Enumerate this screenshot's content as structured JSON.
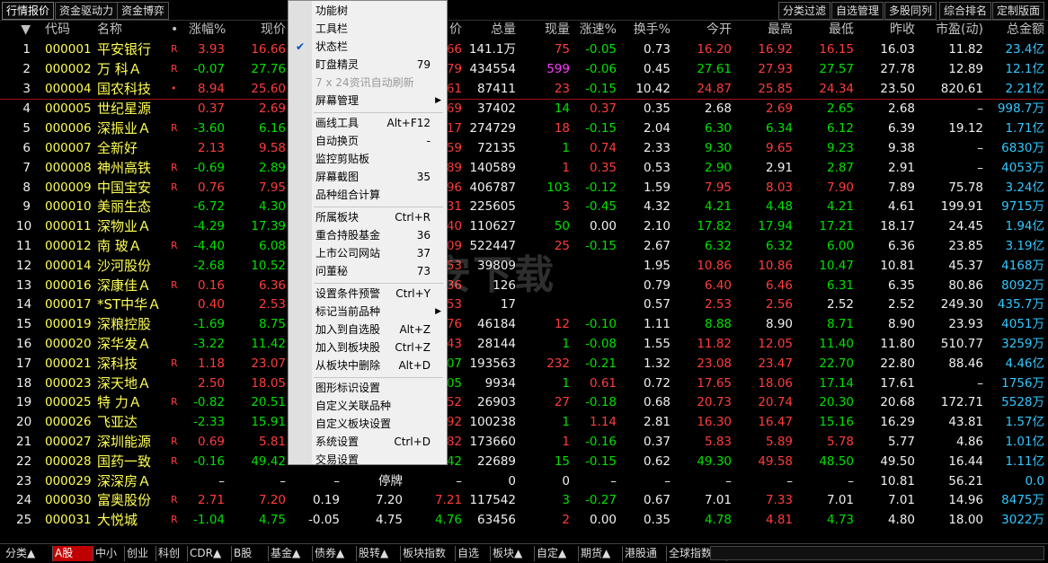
{
  "top_tabs_left": [
    "行情报价",
    "资金驱动力",
    "资金博弈"
  ],
  "top_tabs_right": [
    "分类过滤",
    "自选管理",
    "多股同列",
    "综合排名",
    "定制版面"
  ],
  "header": [
    "▼",
    "代码",
    "名称",
    "•",
    "涨幅%",
    "现价",
    "",
    "",
    "价",
    "总量",
    "现量",
    "涨速%",
    "换手%",
    "今开",
    "最高",
    "最低",
    "昨收",
    "市盈(动)",
    "总金额"
  ],
  "rows": [
    {
      "n": "1",
      "code": "000001",
      "name": "平安银行",
      "mark": "R",
      "chg": "3.93",
      "price": "16.66",
      "hidden1": "",
      "hidden2": "",
      "p2": "66",
      "vol": "141.1万",
      "cur": "75",
      "spd": "-0.05",
      "turn": "0.73",
      "open": "16.20",
      "high": "16.92",
      "low": "16.15",
      "prev": "16.03",
      "pe": "11.82",
      "amt": "23.4亿"
    },
    {
      "n": "2",
      "code": "000002",
      "name": "万 科Ａ",
      "mark": "R",
      "chg": "-0.07",
      "price": "27.76",
      "hidden1": "",
      "hidden2": "",
      "p2": "79",
      "vol": "434554",
      "cur": "599",
      "spd": "-0.06",
      "turn": "0.45",
      "open": "27.61",
      "high": "27.93",
      "low": "27.57",
      "prev": "27.78",
      "pe": "12.89",
      "amt": "12.1亿"
    },
    {
      "n": "3",
      "code": "000004",
      "name": "国农科技",
      "mark": "•",
      "chg": "8.94",
      "price": "25.60",
      "hidden1": "",
      "hidden2": "",
      "p2": "61",
      "vol": "87411",
      "cur": "23",
      "spd": "-0.15",
      "turn": "10.42",
      "open": "24.87",
      "high": "25.85",
      "low": "24.34",
      "prev": "23.50",
      "pe": "820.61",
      "amt": "2.21亿"
    },
    {
      "n": "4",
      "code": "000005",
      "name": "世纪星源",
      "mark": "",
      "chg": "0.37",
      "price": "2.69",
      "hidden1": "",
      "hidden2": "",
      "p2": "69",
      "vol": "37402",
      "cur": "14",
      "spd": "0.37",
      "turn": "0.35",
      "open": "2.68",
      "high": "2.69",
      "low": "2.65",
      "prev": "2.68",
      "pe": "–",
      "amt": "998.7万"
    },
    {
      "n": "5",
      "code": "000006",
      "name": "深振业Ａ",
      "mark": "R",
      "chg": "-3.60",
      "price": "6.16",
      "hidden1": "",
      "hidden2": "",
      "p2": "17",
      "vol": "274729",
      "cur": "18",
      "spd": "-0.15",
      "turn": "2.04",
      "open": "6.30",
      "high": "6.34",
      "low": "6.12",
      "prev": "6.39",
      "pe": "19.12",
      "amt": "1.71亿"
    },
    {
      "n": "6",
      "code": "000007",
      "name": "全新好",
      "mark": "",
      "chg": "2.13",
      "price": "9.58",
      "hidden1": "",
      "hidden2": "",
      "p2": "59",
      "vol": "72135",
      "cur": "1",
      "spd": "0.74",
      "turn": "2.33",
      "open": "9.30",
      "high": "9.65",
      "low": "9.23",
      "prev": "9.38",
      "pe": "–",
      "amt": "6830万"
    },
    {
      "n": "7",
      "code": "000008",
      "name": "神州高铁",
      "mark": "R",
      "chg": "-0.69",
      "price": "2.89",
      "hidden1": "",
      "hidden2": "",
      "p2": "89",
      "vol": "140589",
      "cur": "1",
      "spd": "0.35",
      "turn": "0.53",
      "open": "2.90",
      "high": "2.91",
      "low": "2.87",
      "prev": "2.91",
      "pe": "–",
      "amt": "4053万"
    },
    {
      "n": "8",
      "code": "000009",
      "name": "中国宝安",
      "mark": "R",
      "chg": "0.76",
      "price": "7.95",
      "hidden1": "",
      "hidden2": "",
      "p2": "96",
      "vol": "406787",
      "cur": "103",
      "spd": "-0.12",
      "turn": "1.59",
      "open": "7.95",
      "high": "8.03",
      "low": "7.90",
      "prev": "7.89",
      "pe": "75.78",
      "amt": "3.24亿"
    },
    {
      "n": "9",
      "code": "000010",
      "name": "美丽生态",
      "mark": "",
      "chg": "-6.72",
      "price": "4.30",
      "hidden1": "",
      "hidden2": "",
      "p2": "31",
      "vol": "225605",
      "cur": "3",
      "spd": "-0.45",
      "turn": "4.32",
      "open": "4.21",
      "high": "4.48",
      "low": "4.21",
      "prev": "4.61",
      "pe": "199.91",
      "amt": "9715万"
    },
    {
      "n": "10",
      "code": "000011",
      "name": "深物业Ａ",
      "mark": "",
      "chg": "-4.29",
      "price": "17.39",
      "hidden1": "",
      "hidden2": "",
      "p2": "40",
      "vol": "110627",
      "cur": "50",
      "spd": "0.00",
      "turn": "2.10",
      "open": "17.82",
      "high": "17.94",
      "low": "17.21",
      "prev": "18.17",
      "pe": "24.45",
      "amt": "1.94亿"
    },
    {
      "n": "11",
      "code": "000012",
      "name": "南 玻Ａ",
      "mark": "R",
      "chg": "-4.40",
      "price": "6.08",
      "hidden1": "",
      "hidden2": "",
      "p2": "09",
      "vol": "522447",
      "cur": "25",
      "spd": "-0.15",
      "turn": "2.67",
      "open": "6.32",
      "high": "6.32",
      "low": "6.00",
      "prev": "6.36",
      "pe": "23.85",
      "amt": "3.19亿"
    },
    {
      "n": "12",
      "code": "000014",
      "name": "沙河股份",
      "mark": "",
      "chg": "-2.68",
      "price": "10.52",
      "hidden1": "",
      "hidden2": "",
      "p2": "53",
      "vol": "39809",
      "cur": "",
      "spd": "",
      "turn": "1.95",
      "open": "10.86",
      "high": "10.86",
      "low": "10.47",
      "prev": "10.81",
      "pe": "45.37",
      "amt": "4168万"
    },
    {
      "n": "13",
      "code": "000016",
      "name": "深康佳Ａ",
      "mark": "R",
      "chg": "0.16",
      "price": "6.36",
      "hidden1": "",
      "hidden2": "",
      "p2": "36",
      "vol": "126",
      "cur": "",
      "spd": "",
      "turn": "0.79",
      "open": "6.40",
      "high": "6.46",
      "low": "6.31",
      "prev": "6.35",
      "pe": "80.86",
      "amt": "8092万"
    },
    {
      "n": "14",
      "code": "000017",
      "name": "*ST中华Ａ",
      "mark": "",
      "chg": "0.40",
      "price": "2.53",
      "hidden1": "",
      "hidden2": "",
      "p2": "53",
      "vol": "17",
      "cur": "",
      "spd": "",
      "turn": "0.57",
      "open": "2.53",
      "high": "2.56",
      "low": "2.52",
      "prev": "2.52",
      "pe": "249.30",
      "amt": "435.7万"
    },
    {
      "n": "15",
      "code": "000019",
      "name": "深粮控股",
      "mark": "",
      "chg": "-1.69",
      "price": "8.75",
      "hidden1": "",
      "hidden2": "",
      "p2": "76",
      "vol": "46184",
      "cur": "12",
      "spd": "-0.10",
      "turn": "1.11",
      "open": "8.88",
      "high": "8.90",
      "low": "8.71",
      "prev": "8.90",
      "pe": "23.93",
      "amt": "4051万"
    },
    {
      "n": "16",
      "code": "000020",
      "name": "深华发Ａ",
      "mark": "",
      "chg": "-3.22",
      "price": "11.42",
      "hidden1": "",
      "hidden2": "",
      "p2": "43",
      "vol": "28144",
      "cur": "1",
      "spd": "-0.08",
      "turn": "1.55",
      "open": "11.82",
      "high": "12.05",
      "low": "11.40",
      "prev": "11.80",
      "pe": "510.77",
      "amt": "3259万"
    },
    {
      "n": "17",
      "code": "000021",
      "name": "深科技",
      "mark": "R",
      "chg": "1.18",
      "price": "23.07",
      "hidden1": "",
      "hidden2": "",
      "p2": "07",
      "vol": "193563",
      "cur": "232",
      "spd": "-0.21",
      "turn": "1.32",
      "open": "23.08",
      "high": "23.47",
      "low": "22.70",
      "prev": "22.80",
      "pe": "88.46",
      "amt": "4.46亿"
    },
    {
      "n": "18",
      "code": "000023",
      "name": "深天地Ａ",
      "mark": "",
      "chg": "2.50",
      "price": "18.05",
      "hidden1": "",
      "hidden2": "",
      "p2": "05",
      "vol": "9934",
      "cur": "1",
      "spd": "0.61",
      "turn": "0.72",
      "open": "17.65",
      "high": "18.06",
      "low": "17.14",
      "prev": "17.61",
      "pe": "–",
      "amt": "1756万"
    },
    {
      "n": "19",
      "code": "000025",
      "name": "特 力Ａ",
      "mark": "R",
      "chg": "-0.82",
      "price": "20.51",
      "hidden1": "",
      "hidden2": "",
      "p2": "52",
      "vol": "26903",
      "cur": "27",
      "spd": "-0.18",
      "turn": "0.68",
      "open": "20.73",
      "high": "20.74",
      "low": "20.30",
      "prev": "20.68",
      "pe": "172.71",
      "amt": "5528万"
    },
    {
      "n": "20",
      "code": "000026",
      "name": "飞亚达",
      "mark": "",
      "chg": "-2.33",
      "price": "15.91",
      "hidden1": "",
      "hidden2": "",
      "p2": "92",
      "vol": "100238",
      "cur": "1",
      "spd": "1.14",
      "turn": "2.81",
      "open": "16.30",
      "high": "16.47",
      "low": "15.16",
      "prev": "16.29",
      "pe": "43.81",
      "amt": "1.57亿"
    },
    {
      "n": "21",
      "code": "000027",
      "name": "深圳能源",
      "mark": "R",
      "chg": "0.69",
      "price": "5.81",
      "hidden1": "",
      "hidden2": "",
      "p2": "82",
      "vol": "173660",
      "cur": "1",
      "spd": "-0.16",
      "turn": "0.37",
      "open": "5.83",
      "high": "5.89",
      "low": "5.78",
      "prev": "5.77",
      "pe": "4.86",
      "amt": "1.01亿"
    },
    {
      "n": "22",
      "code": "000028",
      "name": "国药一致",
      "mark": "R",
      "chg": "-0.16",
      "price": "49.42",
      "hidden1": "",
      "hidden2": "",
      "p2": "42",
      "vol": "22689",
      "cur": "15",
      "spd": "-0.15",
      "turn": "0.62",
      "open": "49.30",
      "high": "49.58",
      "low": "48.50",
      "prev": "49.50",
      "pe": "16.44",
      "amt": "1.11亿"
    },
    {
      "n": "23",
      "code": "000029",
      "name": "深深房Ａ",
      "mark": "",
      "chg": "–",
      "price": "–",
      "hidden1": "–",
      "hidden2": "停牌",
      "p2": "–",
      "vol": "0",
      "cur": "0",
      "spd": "–",
      "turn": "–",
      "open": "–",
      "high": "–",
      "low": "–",
      "prev": "10.81",
      "pe": "56.21",
      "amt": "0.0"
    },
    {
      "n": "24",
      "code": "000030",
      "name": "富奥股份",
      "mark": "R",
      "chg": "2.71",
      "price": "7.20",
      "hidden1": "0.19",
      "hidden2": "7.20",
      "p2": "7.21",
      "vol": "117542",
      "cur": "3",
      "spd": "-0.27",
      "turn": "0.67",
      "open": "7.01",
      "high": "7.33",
      "low": "7.01",
      "prev": "7.01",
      "pe": "14.96",
      "amt": "8475万"
    },
    {
      "n": "25",
      "code": "000031",
      "name": "大悦城",
      "mark": "R",
      "chg": "-1.04",
      "price": "4.75",
      "hidden1": "-0.05",
      "hidden2": "4.75",
      "p2": "4.76",
      "vol": "63456",
      "cur": "2",
      "spd": "0.00",
      "turn": "0.35",
      "open": "4.78",
      "high": "4.81",
      "low": "4.73",
      "prev": "4.80",
      "pe": "18.00",
      "amt": "3022万"
    }
  ],
  "menu": {
    "items": [
      {
        "label": "功能树",
        "shortcut": "",
        "type": "item"
      },
      {
        "label": "工具栏",
        "shortcut": "",
        "type": "item"
      },
      {
        "label": "状态栏",
        "shortcut": "",
        "type": "checked"
      },
      {
        "label": "盯盘精灵",
        "shortcut": "79",
        "type": "item"
      },
      {
        "label": "7 x 24资讯自动刷新",
        "shortcut": "",
        "type": "disabled"
      },
      {
        "label": "屏幕管理",
        "shortcut": "",
        "type": "submenu"
      },
      {
        "label": "",
        "shortcut": "",
        "type": "divider"
      },
      {
        "label": "画线工具",
        "shortcut": "Alt+F12",
        "type": "item"
      },
      {
        "label": "自动换页",
        "shortcut": "-",
        "type": "item"
      },
      {
        "label": "监控剪贴板",
        "shortcut": "",
        "type": "item"
      },
      {
        "label": "屏幕截图",
        "shortcut": "35",
        "type": "item"
      },
      {
        "label": "品种组合计算",
        "shortcut": "",
        "type": "item"
      },
      {
        "label": "",
        "shortcut": "",
        "type": "divider"
      },
      {
        "label": "所属板块",
        "shortcut": "Ctrl+R",
        "type": "item"
      },
      {
        "label": "重合持股基金",
        "shortcut": "36",
        "type": "item"
      },
      {
        "label": "上市公司网站",
        "shortcut": "37",
        "type": "item"
      },
      {
        "label": "问董秘",
        "shortcut": "73",
        "type": "item"
      },
      {
        "label": "",
        "shortcut": "",
        "type": "divider"
      },
      {
        "label": "设置条件预警",
        "shortcut": "Ctrl+Y",
        "type": "item"
      },
      {
        "label": "标记当前品种",
        "shortcut": "",
        "type": "submenu"
      },
      {
        "label": "加入到自选股",
        "shortcut": "Alt+Z",
        "type": "item"
      },
      {
        "label": "加入到板块股",
        "shortcut": "Ctrl+Z",
        "type": "item"
      },
      {
        "label": "从板块中删除",
        "shortcut": "Alt+D",
        "type": "item"
      },
      {
        "label": "",
        "shortcut": "",
        "type": "divider"
      },
      {
        "label": "图形标识设置",
        "shortcut": "",
        "type": "item"
      },
      {
        "label": "自定义关联品种",
        "shortcut": "",
        "type": "item"
      },
      {
        "label": "自定义板块设置",
        "shortcut": "",
        "type": "item"
      },
      {
        "label": "系统设置",
        "shortcut": "Ctrl+D",
        "type": "item"
      },
      {
        "label": "交易设置",
        "shortcut": "",
        "type": "item"
      }
    ]
  },
  "bottom_tabs": [
    "分类▲",
    "A股",
    "中小",
    "创业",
    "科创",
    "CDR▲",
    "B股",
    "基金▲",
    "债券▲",
    "股转▲",
    "板块指数",
    "自选",
    "板块▲",
    "自定▲",
    "期货▲",
    "港股通",
    "全球指数"
  ],
  "bottom_active": "A股",
  "watermark": "安下载"
}
